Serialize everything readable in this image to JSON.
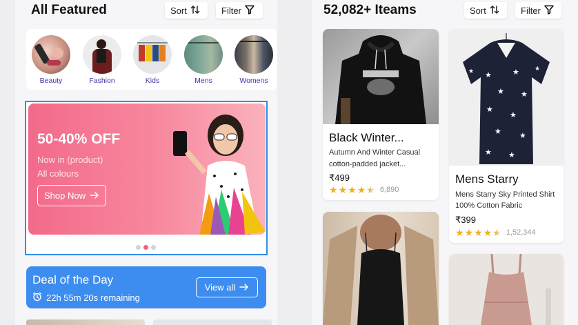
{
  "left_panel": {
    "title": "All Featured",
    "sort_label": "Sort",
    "filter_label": "Filter",
    "categories": [
      {
        "label": "Beauty"
      },
      {
        "label": "Fashion"
      },
      {
        "label": "Kids"
      },
      {
        "label": "Mens"
      },
      {
        "label": "Womens"
      }
    ],
    "banner": {
      "headline": "50-40% OFF",
      "line1": "Now in (product)",
      "line2": "All colours",
      "cta": "Shop Now",
      "active_slide": 2,
      "slide_count": 3
    },
    "deal": {
      "title": "Deal of the Day",
      "timer": "22h 55m 20s remaining",
      "cta": "View all"
    }
  },
  "right_panel": {
    "title": "52,082+ Iteams",
    "sort_label": "Sort",
    "filter_label": "Filter",
    "products": [
      {
        "name": "Black Winter...",
        "desc1": "Autumn And Winter Casual",
        "desc2": "cotton-padded jacket...",
        "price": "₹499",
        "rating": 4.5,
        "count": "6,890"
      },
      {
        "name": "Mens Starry",
        "desc1": "Mens Starry Sky Printed Shirt",
        "desc2": "100% Cotton Fabric",
        "price": "₹399",
        "rating": 4.5,
        "count": "1,52,344"
      }
    ]
  },
  "colors": {
    "accent_blue": "#3d8df0",
    "banner_pink": "#f36a8a",
    "star": "#f2b01e",
    "category_label": "#4a2fa8"
  },
  "icons": [
    "sort-icon",
    "filter-icon",
    "arrow-right-icon",
    "alarm-clock-icon",
    "star-icon"
  ]
}
